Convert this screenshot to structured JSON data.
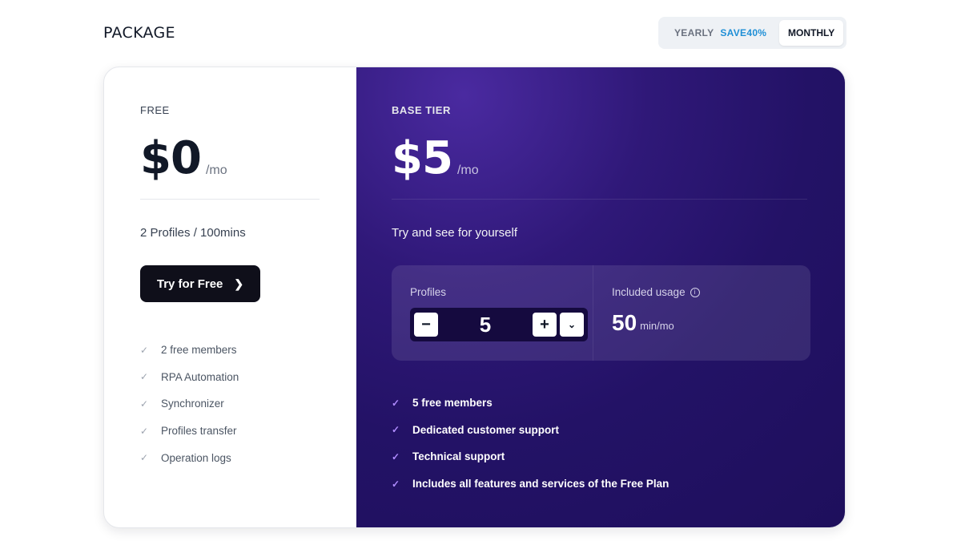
{
  "header": {
    "title": "PACKAGE"
  },
  "billing_toggle": {
    "yearly_label": "YEARLY",
    "save_label": "SAVE40%",
    "monthly_label": "MONTHLY",
    "selected": "MONTHLY"
  },
  "plans": {
    "free": {
      "tier": "FREE",
      "price": "$0",
      "period": "/mo",
      "description": "2 Profiles / 100mins",
      "cta_label": "Try for Free",
      "features": [
        "2 free members",
        "RPA Automation",
        "Synchronizer",
        "Profiles transfer",
        "Operation logs"
      ]
    },
    "base": {
      "tier": "BASE TIER",
      "price": "$5",
      "period": "/mo",
      "description": "Try and see for yourself",
      "profiles_label": "Profiles",
      "profiles_value": "5",
      "usage_label": "Included usage",
      "usage_value": "50",
      "usage_unit": "min/mo",
      "features": [
        "5 free members",
        "Dedicated customer support",
        "Technical support",
        "Includes all features and services of the Free Plan"
      ]
    }
  },
  "colors": {
    "accent": "#1f8fd6",
    "card_dark": "#231266",
    "check_purple": "#b08cff"
  }
}
